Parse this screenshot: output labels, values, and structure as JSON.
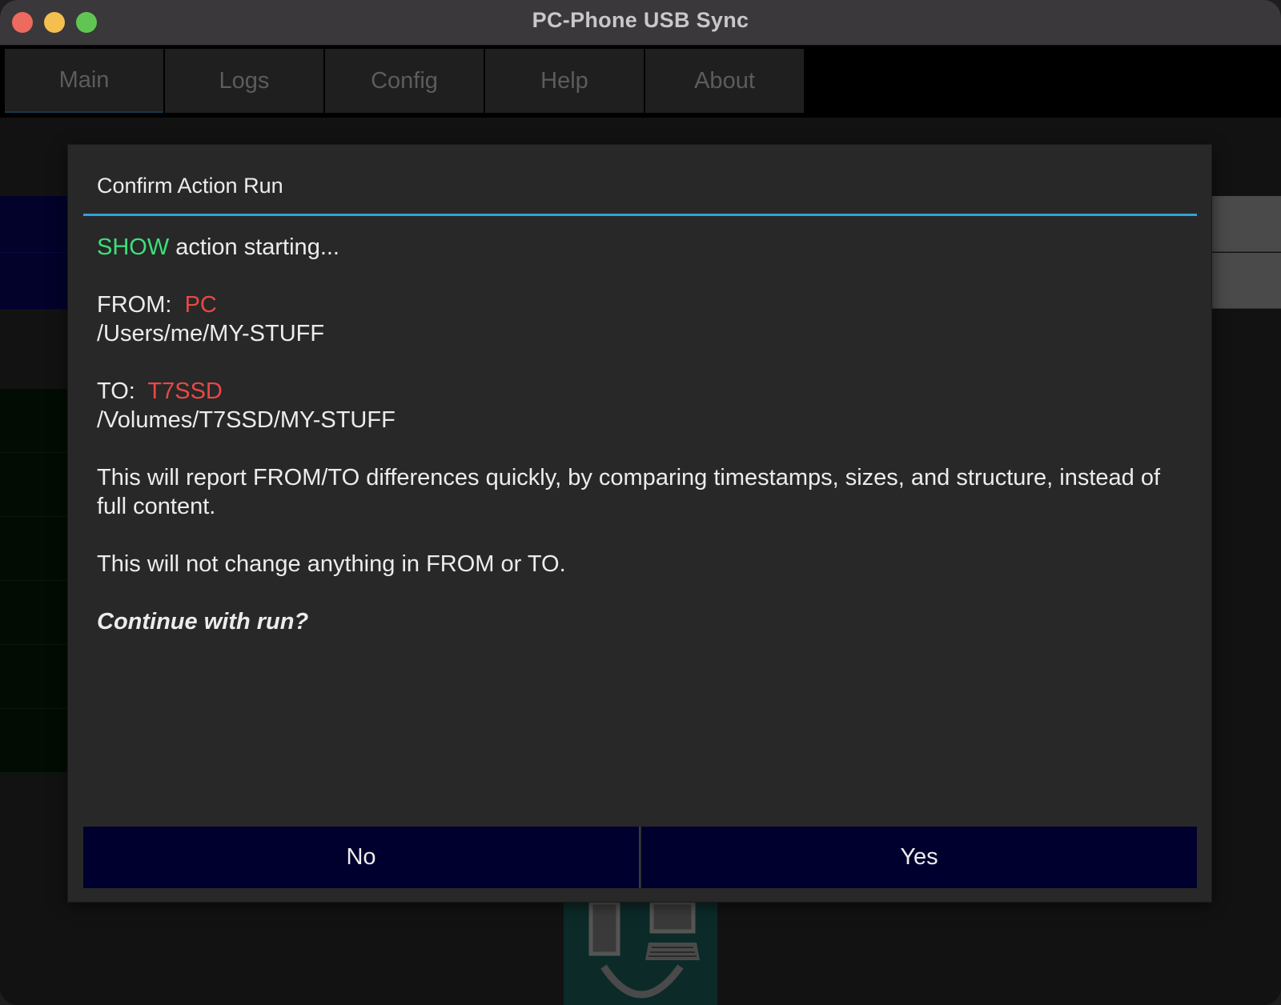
{
  "window": {
    "title": "PC-Phone USB Sync"
  },
  "tabs": [
    {
      "label": "Main",
      "active": true
    },
    {
      "label": "Logs",
      "active": false
    },
    {
      "label": "Config",
      "active": false
    },
    {
      "label": "Help",
      "active": false
    },
    {
      "label": "About",
      "active": false
    }
  ],
  "dialog": {
    "title": "Confirm Action Run",
    "action_word": "SHOW",
    "action_rest": " action starting...",
    "from_label": "FROM:",
    "from_device": "PC",
    "from_path": "/Users/me/MY-STUFF",
    "to_label": "TO:",
    "to_device": "T7SSD",
    "to_path": "/Volumes/T7SSD/MY-STUFF",
    "description": "This will report FROM/TO differences quickly, by comparing timestamps, sizes, and structure, instead of full content.",
    "note": "This will not change anything in FROM or TO.",
    "prompt": "Continue with run?",
    "no_label": "No",
    "yes_label": "Yes"
  },
  "colors": {
    "accent_rule": "#30a3da",
    "action_green": "#3de07a",
    "device_red": "#e84848",
    "button_bg": "#00002e"
  }
}
